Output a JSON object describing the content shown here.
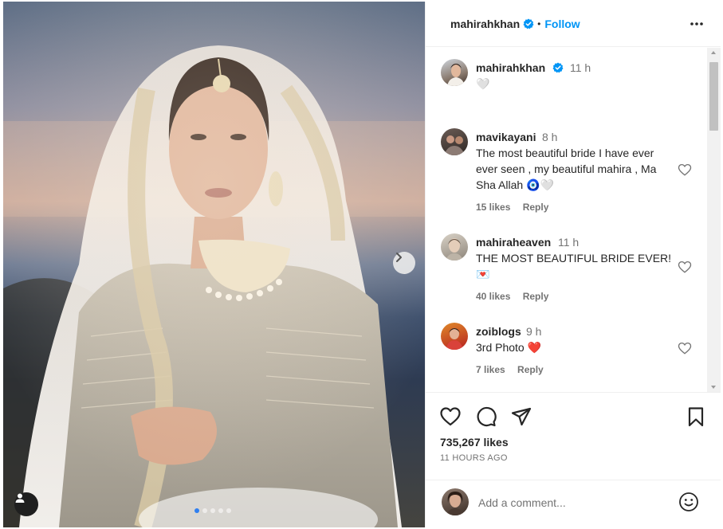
{
  "post": {
    "header": {
      "username": "mahirahkhan",
      "separator": "•",
      "follow_label": "Follow"
    },
    "photo": {
      "carousel_count": 5,
      "active_index": 0
    },
    "caption": {
      "username": "mahirahkhan",
      "time": "11 h",
      "text": "🤍"
    },
    "comments": [
      {
        "username": "mavikayani",
        "time": "8 h",
        "text": "The most beautiful bride I have ever ever seen , my beautiful mahira , Ma Sha Allah 🧿🤍",
        "likes": "15 likes",
        "reply_label": "Reply"
      },
      {
        "username": "mahiraheaven",
        "time": "11 h",
        "text": "THE MOST BEAUTIFUL BRIDE EVER! 💌",
        "likes": "40 likes",
        "reply_label": "Reply"
      },
      {
        "username": "zoiblogs",
        "time": "9 h",
        "text": "3rd Photo ❤️",
        "likes": "7 likes",
        "reply_label": "Reply"
      }
    ],
    "likes_count": "735,267 likes",
    "posted": "11 HOURS AGO",
    "add_comment": {
      "placeholder": "Add a comment..."
    },
    "colors": {
      "accent": "#0095f6",
      "verified": "#0095f6",
      "carousel_active": "#2f7ff0"
    },
    "icons": {
      "verified": "verified-badge-icon",
      "more": "more-options-icon",
      "like": "heart-icon",
      "comment": "comment-icon",
      "share": "share-icon",
      "save": "bookmark-icon",
      "emoji": "emoji-icon",
      "next": "chevron-right-icon",
      "tags": "user-tag-icon"
    }
  }
}
